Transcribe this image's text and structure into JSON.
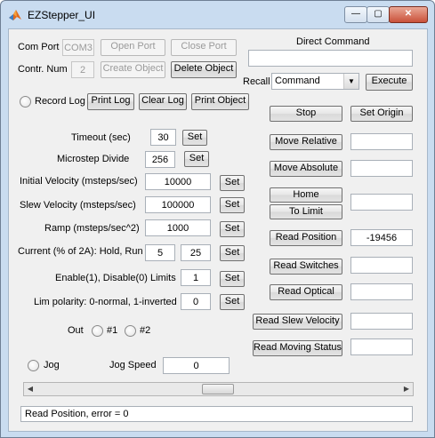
{
  "window": {
    "title": "EZStepper_UI",
    "minimize_glyph": "—",
    "maximize_glyph": "▢",
    "close_glyph": "✕"
  },
  "com_port": {
    "label": "Com Port",
    "value": "COM3",
    "open_label": "Open Port",
    "close_label": "Close Port"
  },
  "controller": {
    "label": "Contr. Num",
    "value": "2",
    "create_label": "Create Object",
    "delete_label": "Delete Object"
  },
  "log": {
    "record_label": "Record Log",
    "print_label": "Print Log",
    "clear_label": "Clear Log",
    "print_object_label": "Print Object"
  },
  "params": {
    "timeout": {
      "label": "Timeout (sec)",
      "value": "30",
      "set": "Set"
    },
    "microstep": {
      "label": "Microstep Divide",
      "value": "256",
      "set": "Set"
    },
    "initial_velocity": {
      "label": "Initial Velocity (msteps/sec)",
      "value": "10000",
      "set": "Set"
    },
    "slew_velocity": {
      "label": "Slew Velocity (msteps/sec)",
      "value": "100000",
      "set": "Set"
    },
    "ramp": {
      "label": "Ramp (msteps/sec^2)",
      "value": "1000",
      "set": "Set"
    },
    "current": {
      "label": "Current (% of 2A): Hold, Run",
      "hold": "5",
      "run": "25",
      "set": "Set"
    },
    "limits": {
      "label": "Enable(1), Disable(0) Limits",
      "value": "1",
      "set": "Set"
    },
    "lim_polarity": {
      "label": "Lim polarity: 0-normal, 1-inverted",
      "value": "0",
      "set": "Set"
    }
  },
  "out": {
    "label": "Out",
    "opt1": "#1",
    "opt2": "#2"
  },
  "jog": {
    "label": "Jog",
    "speed_label": "Jog Speed",
    "speed_value": "0"
  },
  "direct_command": {
    "label": "Direct Command",
    "value": "",
    "recall_label": "Recall",
    "recall_selected": "Command",
    "execute": "Execute"
  },
  "actions": {
    "stop": "Stop",
    "set_origin": "Set Origin",
    "move_relative": "Move Relative",
    "move_relative_value": "",
    "move_absolute": "Move Absolute",
    "move_absolute_value": "",
    "home": "Home",
    "to_limit": "To Limit",
    "home_value": "",
    "read_position": "Read Position",
    "position_value": "-19456",
    "read_switches": "Read Switches",
    "switches_value": "",
    "read_optical": "Read Optical",
    "optical_value": "",
    "read_slew_velocity": "Read Slew Velocity",
    "slew_velocity_value": "",
    "read_moving_status": "Read Moving Status",
    "moving_status_value": ""
  },
  "status_bar": {
    "text": "Read Position, error = 0"
  },
  "colors": {
    "frame": "#c9dcf0",
    "client": "#f0f0f0",
    "close_button": "#c9513a"
  },
  "icons": {
    "app": "matlab-logo-icon",
    "scroll_left": "arrow-left-icon",
    "scroll_right": "arrow-right-icon",
    "dropdown": "chevron-down-icon"
  }
}
